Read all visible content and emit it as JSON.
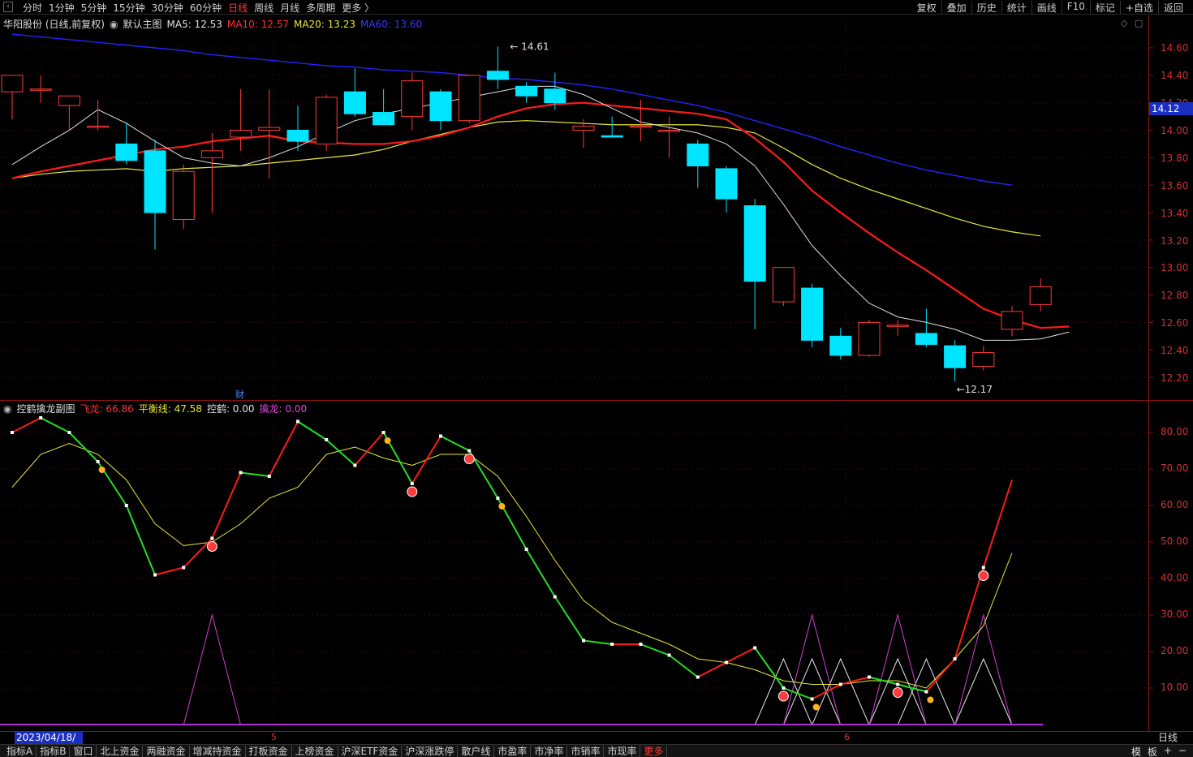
{
  "topbar": {
    "periods": [
      "分时",
      "1分钟",
      "5分钟",
      "15分钟",
      "30分钟",
      "60分钟",
      "日线",
      "周线",
      "月线",
      "多周期",
      "更多 〉"
    ],
    "active_period": "日线",
    "tools": [
      "复权",
      "叠加",
      "历史",
      "统计",
      "画线",
      "F10",
      "标记",
      "+自选",
      "返回"
    ]
  },
  "main_panel": {
    "stock": "华阳股份 (日线,前复权)",
    "template": "默认主图",
    "ma5": "MA5: 12.53",
    "ma10": "MA10: 12.57",
    "ma20": "MA20: 13.23",
    "ma60": "MA60: 13.60",
    "y_ticks": [
      "14.60",
      "14.40",
      "14.20",
      "14.00",
      "13.80",
      "13.60",
      "13.40",
      "13.20",
      "13.00",
      "12.80",
      "12.60",
      "12.40",
      "12.20"
    ],
    "current_price": "14.12",
    "high_label": "14.61",
    "low_label": "12.17",
    "event_mark": "财",
    "colors": {
      "up": "#ff3b3b",
      "down": "#00e5ff",
      "ma5": "#e0e0e0",
      "ma10": "#ff1a1a",
      "ma20": "#e8e83a",
      "ma60": "#2323ff"
    }
  },
  "sub_panel": {
    "title": "控鹤擒龙副图",
    "fei_long": "飞龙: 66.86",
    "ping_heng": "平衡线: 47.58",
    "kong_he": "控鹤: 0.00",
    "qin_long": "擒龙: 0.00",
    "y_ticks": [
      "80.00",
      "70.00",
      "60.00",
      "50.00",
      "40.00",
      "30.00",
      "20.00",
      "10.00"
    ]
  },
  "chart_data": {
    "type": "candlestick",
    "ylim": [
      12.1,
      14.75
    ],
    "candles": [
      {
        "o": 14.28,
        "h": 14.4,
        "l": 14.08,
        "c": 14.4
      },
      {
        "o": 14.3,
        "h": 14.4,
        "l": 14.2,
        "c": 14.3
      },
      {
        "o": 14.18,
        "h": 14.18,
        "l": 14.0,
        "c": 14.25
      },
      {
        "o": 14.03,
        "h": 14.22,
        "l": 14.0,
        "c": 14.03
      },
      {
        "o": 13.9,
        "h": 14.06,
        "l": 13.75,
        "c": 13.78
      },
      {
        "o": 13.85,
        "h": 13.93,
        "l": 13.13,
        "c": 13.4
      },
      {
        "o": 13.35,
        "h": 13.75,
        "l": 13.28,
        "c": 13.7
      },
      {
        "o": 13.8,
        "h": 13.98,
        "l": 13.4,
        "c": 13.85
      },
      {
        "o": 13.95,
        "h": 14.3,
        "l": 13.85,
        "c": 14.0
      },
      {
        "o": 14.0,
        "h": 14.3,
        "l": 13.65,
        "c": 14.02
      },
      {
        "o": 14.0,
        "h": 14.18,
        "l": 13.85,
        "c": 13.92
      },
      {
        "o": 13.9,
        "h": 14.26,
        "l": 13.85,
        "c": 14.24
      },
      {
        "o": 14.28,
        "h": 14.45,
        "l": 14.1,
        "c": 14.12
      },
      {
        "o": 14.13,
        "h": 14.3,
        "l": 14.05,
        "c": 14.04
      },
      {
        "o": 14.1,
        "h": 14.42,
        "l": 14.0,
        "c": 14.36
      },
      {
        "o": 14.28,
        "h": 14.3,
        "l": 14.0,
        "c": 14.07
      },
      {
        "o": 14.07,
        "h": 14.4,
        "l": 14.05,
        "c": 14.4
      },
      {
        "o": 14.43,
        "h": 14.61,
        "l": 14.3,
        "c": 14.37
      },
      {
        "o": 14.32,
        "h": 14.35,
        "l": 14.2,
        "c": 14.25
      },
      {
        "o": 14.3,
        "h": 14.42,
        "l": 14.15,
        "c": 14.2
      },
      {
        "o": 14.0,
        "h": 14.08,
        "l": 13.87,
        "c": 14.03
      },
      {
        "o": 13.96,
        "h": 14.1,
        "l": 13.95,
        "c": 13.95
      },
      {
        "o": 14.03,
        "h": 14.22,
        "l": 13.92,
        "c": 14.03
      },
      {
        "o": 14.0,
        "h": 14.1,
        "l": 13.8,
        "c": 14.0
      },
      {
        "o": 13.9,
        "h": 13.93,
        "l": 13.58,
        "c": 13.74
      },
      {
        "o": 13.72,
        "h": 13.74,
        "l": 13.4,
        "c": 13.5
      },
      {
        "o": 13.45,
        "h": 13.5,
        "l": 12.55,
        "c": 12.9
      },
      {
        "o": 12.75,
        "h": 13.0,
        "l": 12.72,
        "c": 13.0
      },
      {
        "o": 12.85,
        "h": 12.88,
        "l": 12.42,
        "c": 12.47
      },
      {
        "o": 12.5,
        "h": 12.56,
        "l": 12.33,
        "c": 12.36
      },
      {
        "o": 12.36,
        "h": 12.62,
        "l": 12.35,
        "c": 12.6
      },
      {
        "o": 12.58,
        "h": 12.62,
        "l": 12.5,
        "c": 12.58
      },
      {
        "o": 12.52,
        "h": 12.7,
        "l": 12.42,
        "c": 12.44
      },
      {
        "o": 12.43,
        "h": 12.47,
        "l": 12.17,
        "c": 12.27
      },
      {
        "o": 12.28,
        "h": 12.43,
        "l": 12.25,
        "c": 12.38
      },
      {
        "o": 12.55,
        "h": 12.72,
        "l": 12.5,
        "c": 12.68
      },
      {
        "o": 12.73,
        "h": 12.92,
        "l": 12.68,
        "c": 12.86
      }
    ],
    "ma5": [
      13.75,
      13.88,
      14.0,
      14.15,
      14.05,
      13.92,
      13.8,
      13.76,
      13.74,
      13.8,
      13.88,
      13.98,
      14.07,
      14.12,
      14.16,
      14.2,
      14.24,
      14.28,
      14.32,
      14.32,
      14.26,
      14.16,
      14.06,
      14.02,
      13.98,
      13.9,
      13.74,
      13.46,
      13.16,
      12.94,
      12.74,
      12.64,
      12.6,
      12.55,
      12.47,
      12.47,
      12.48,
      12.53
    ],
    "ma10": [
      13.65,
      13.7,
      13.74,
      13.78,
      13.82,
      13.86,
      13.88,
      13.92,
      13.94,
      13.96,
      13.92,
      13.91,
      13.9,
      13.9,
      13.92,
      13.96,
      14.02,
      14.1,
      14.16,
      14.19,
      14.2,
      14.18,
      14.16,
      14.14,
      14.12,
      14.08,
      13.94,
      13.77,
      13.56,
      13.4,
      13.25,
      13.11,
      12.98,
      12.84,
      12.7,
      12.62,
      12.56,
      12.57
    ],
    "ma20": [
      13.65,
      13.68,
      13.7,
      13.71,
      13.72,
      13.7,
      13.72,
      13.73,
      13.74,
      13.76,
      13.78,
      13.8,
      13.82,
      13.86,
      13.92,
      13.97,
      14.02,
      14.06,
      14.07,
      14.06,
      14.05,
      14.04,
      14.04,
      14.04,
      14.04,
      14.02,
      13.98,
      13.87,
      13.75,
      13.65,
      13.57,
      13.5,
      13.43,
      13.36,
      13.3,
      13.26,
      13.23
    ],
    "ma60": [
      14.7,
      14.68,
      14.66,
      14.64,
      14.62,
      14.6,
      14.58,
      14.55,
      14.53,
      14.51,
      14.49,
      14.47,
      14.46,
      14.44,
      14.43,
      14.42,
      14.4,
      14.38,
      14.37,
      14.35,
      14.33,
      14.3,
      14.26,
      14.22,
      14.18,
      14.13,
      14.07,
      14.01,
      13.95,
      13.88,
      13.82,
      13.76,
      13.71,
      13.67,
      13.63,
      13.6
    ],
    "sub": {
      "ylim": [
        0,
        90
      ],
      "fei_long": [
        80,
        84,
        80,
        72,
        60,
        41,
        43,
        51,
        69,
        68,
        83,
        78,
        71,
        80,
        66,
        79,
        75,
        62,
        48,
        35,
        23,
        22,
        22,
        19,
        13,
        17,
        21,
        10,
        7,
        11,
        13,
        11,
        9,
        18,
        43,
        67
      ],
      "ping_heng": [
        65,
        74,
        77,
        74,
        67,
        55,
        49,
        50,
        55,
        62,
        65,
        74,
        76,
        73,
        71,
        74,
        74,
        68,
        57,
        45,
        34,
        28,
        25,
        22,
        18,
        17,
        15,
        12,
        11,
        11,
        12,
        12,
        10,
        18,
        27,
        47
      ],
      "kong_he_peaks": [
        27,
        28,
        29,
        31,
        32,
        34
      ],
      "qin_long_peaks": [
        7,
        28,
        31,
        34
      ]
    },
    "x_labels": [
      "2023/04/18/二",
      "5",
      "6"
    ]
  },
  "bottombar": {
    "tabs": [
      "指标A",
      "指标B",
      "窗口",
      "北上资金",
      "两融资金",
      "增减持资金",
      "打板资金",
      "上榜资金",
      "沪深ETF资金",
      "沪深涨跌停",
      "散户线",
      "市盈率",
      "市净率",
      "市销率",
      "市现率",
      "更多"
    ],
    "right": [
      "模",
      "板",
      "+",
      "−"
    ],
    "period_label": "日线"
  }
}
